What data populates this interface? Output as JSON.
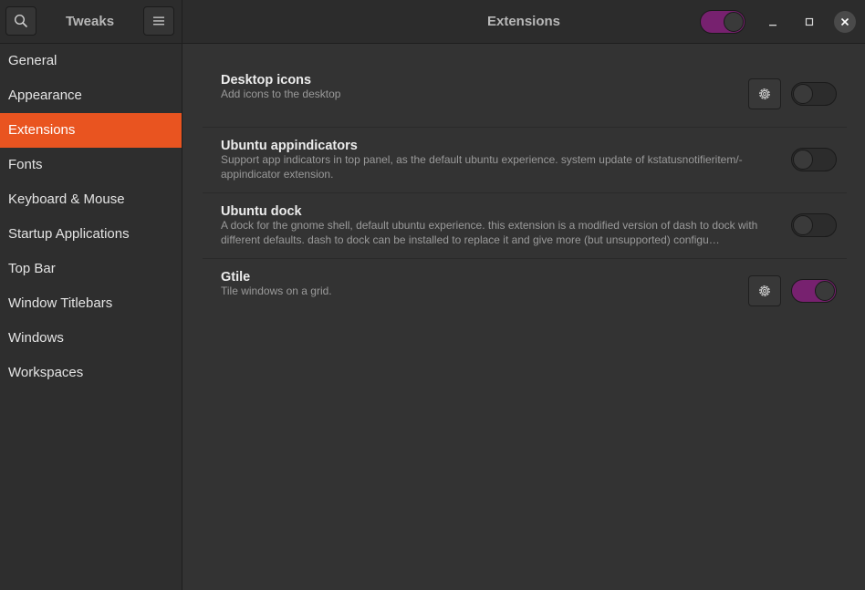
{
  "app": {
    "title": "Tweaks"
  },
  "header": {
    "page_title": "Extensions",
    "extensions_enabled": true,
    "accent_color": "#77216f"
  },
  "icons": {
    "search": "search-icon",
    "menu": "hamburger-menu-icon",
    "minimize": "minimize-icon",
    "maximize": "maximize-icon",
    "close": "close-icon",
    "settings": "gear-icon"
  },
  "sidebar": {
    "active_color": "#e95420",
    "items": [
      {
        "label": "General"
      },
      {
        "label": "Appearance"
      },
      {
        "label": "Extensions",
        "active": true
      },
      {
        "label": "Fonts"
      },
      {
        "label": "Keyboard & Mouse"
      },
      {
        "label": "Startup Applications"
      },
      {
        "label": "Top Bar"
      },
      {
        "label": "Window Titlebars"
      },
      {
        "label": "Windows"
      },
      {
        "label": "Workspaces"
      }
    ]
  },
  "extensions": [
    {
      "name": "Desktop icons",
      "description": "Add icons to the desktop",
      "has_settings": true,
      "enabled": false
    },
    {
      "name": "Ubuntu appindicators",
      "description": "Support app indicators in top panel, as the default ubuntu experience. system update of kstatusnotifieritem/-appindicator extension.",
      "has_settings": false,
      "enabled": false
    },
    {
      "name": "Ubuntu dock",
      "description": "A dock for the gnome shell, default ubuntu experience. this extension is a modified version of dash to dock with different defaults. dash to dock can be installed to replace it and give more (but unsupported) configu…",
      "has_settings": false,
      "enabled": false
    },
    {
      "name": "Gtile",
      "description": "Tile windows on a grid.",
      "has_settings": true,
      "enabled": true
    }
  ]
}
